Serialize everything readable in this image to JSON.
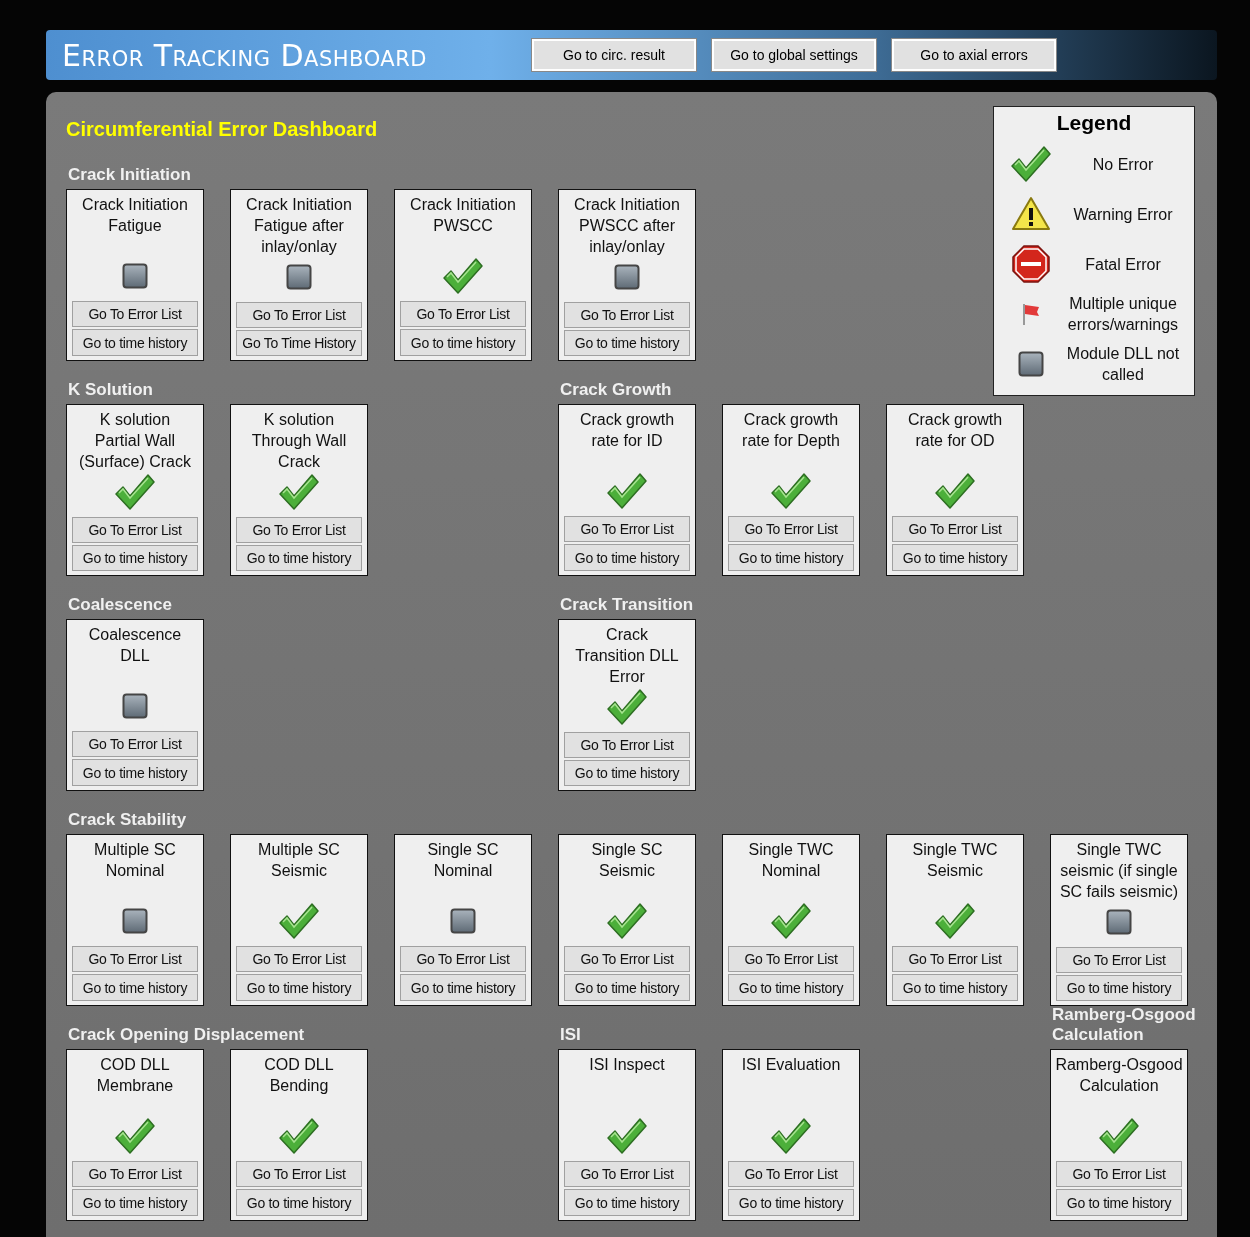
{
  "header": {
    "title": "Error Tracking Dashboard",
    "buttons": [
      "Go to circ. result",
      "Go to global settings",
      "Go to axial errors"
    ]
  },
  "dashboard": {
    "title": "Circumferential Error Dashboard",
    "legend": {
      "title": "Legend",
      "items": [
        {
          "kind": "ok",
          "label": "No Error"
        },
        {
          "kind": "warning",
          "label": "Warning Error"
        },
        {
          "kind": "fatal",
          "label": "Fatal Error"
        },
        {
          "kind": "flag",
          "label": "Multiple unique\nerrors/warnings"
        },
        {
          "kind": "not_called",
          "label": "Module DLL not\ncalled"
        }
      ]
    },
    "rows": [
      {
        "sections": [
          {
            "title": "Crack Initiation",
            "cards": [
              {
                "title": "Crack Initiation\nFatigue",
                "kind": "not_called",
                "buttons": [
                  "Go To Error List",
                  "Go to time history"
                ]
              },
              {
                "title": "Crack Initiation\nFatigue after\ninlay/onlay",
                "kind": "not_called",
                "buttons": [
                  "Go To Error List",
                  "Go To Time History"
                ]
              },
              {
                "title": "Crack Initiation\nPWSCC",
                "kind": "ok",
                "buttons": [
                  "Go To Error List",
                  "Go to time history"
                ]
              },
              {
                "title": "Crack Initiation\nPWSCC after\ninlay/onlay",
                "kind": "not_called",
                "buttons": [
                  "Go To Error List",
                  "Go to time history"
                ]
              }
            ]
          }
        ]
      },
      {
        "sections": [
          {
            "title": "K Solution",
            "cards": [
              {
                "title": "K solution\nPartial Wall\n(Surface) Crack",
                "kind": "ok",
                "buttons": [
                  "Go To Error List",
                  "Go to time history"
                ]
              },
              {
                "title": "K solution\nThrough Wall\nCrack",
                "kind": "ok",
                "buttons": [
                  "Go To Error List",
                  "Go to time history"
                ]
              }
            ]
          },
          {
            "title": "Crack Growth",
            "cards": [
              {
                "title": "Crack growth\nrate for ID",
                "kind": "ok",
                "buttons": [
                  "Go To Error List",
                  "Go to time history"
                ]
              },
              {
                "title": "Crack growth\nrate for Depth",
                "kind": "ok",
                "buttons": [
                  "Go To Error List",
                  "Go to time history"
                ]
              },
              {
                "title": "Crack growth\nrate for OD",
                "kind": "ok",
                "buttons": [
                  "Go To Error List",
                  "Go to time history"
                ]
              }
            ]
          }
        ]
      },
      {
        "sections": [
          {
            "title": "Coalescence",
            "cards": [
              {
                "title": "Coalescence\nDLL",
                "kind": "not_called",
                "buttons": [
                  "Go To Error List",
                  "Go to time history"
                ]
              }
            ]
          },
          {
            "title": "Crack Transition",
            "cards": [
              {
                "title": "Crack\nTransition DLL\nError",
                "kind": "ok",
                "buttons": [
                  "Go To Error List",
                  "Go to time history"
                ]
              }
            ]
          }
        ]
      },
      {
        "sections": [
          {
            "title": "Crack Stability",
            "cards": [
              {
                "title": "Multiple SC\nNominal",
                "kind": "not_called",
                "buttons": [
                  "Go To Error List",
                  "Go to time history"
                ]
              },
              {
                "title": "Multiple SC\nSeismic",
                "kind": "ok",
                "buttons": [
                  "Go To Error List",
                  "Go to time history"
                ]
              },
              {
                "title": "Single SC\nNominal",
                "kind": "not_called",
                "buttons": [
                  "Go To Error List",
                  "Go to time history"
                ]
              },
              {
                "title": "Single SC\nSeismic",
                "kind": "ok",
                "buttons": [
                  "Go To Error List",
                  "Go to time history"
                ]
              },
              {
                "title": "Single TWC\nNominal",
                "kind": "ok",
                "buttons": [
                  "Go To Error List",
                  "Go to time history"
                ]
              },
              {
                "title": "Single TWC\nSeismic",
                "kind": "ok",
                "buttons": [
                  "Go To Error List",
                  "Go to time history"
                ]
              },
              {
                "title": "Single TWC\nseismic (if single\nSC fails seismic)",
                "kind": "not_called",
                "buttons": [
                  "Go To Error List",
                  "Go to time history"
                ]
              }
            ]
          }
        ]
      },
      {
        "sections": [
          {
            "title": "Crack Opening Displacement",
            "cards": [
              {
                "title": "COD DLL\nMembrane",
                "kind": "ok",
                "buttons": [
                  "Go To Error List",
                  "Go to time history"
                ]
              },
              {
                "title": "COD DLL\nBending",
                "kind": "ok",
                "buttons": [
                  "Go To Error List",
                  "Go to time history"
                ]
              }
            ]
          },
          {
            "title": "ISI",
            "cards": [
              {
                "title": "ISI Inspect",
                "kind": "ok",
                "buttons": [
                  "Go To Error List",
                  "Go to time history"
                ]
              },
              {
                "title": "ISI Evaluation",
                "kind": "ok",
                "buttons": [
                  "Go To Error List",
                  "Go to time history"
                ]
              }
            ]
          },
          {
            "title": "Ramberg-Osgood\nCalculation",
            "cards": [
              {
                "title": "Ramberg-Osgood\nCalculation",
                "kind": "ok",
                "buttons": [
                  "Go To Error List",
                  "Go to time history"
                ]
              }
            ]
          }
        ]
      }
    ]
  }
}
